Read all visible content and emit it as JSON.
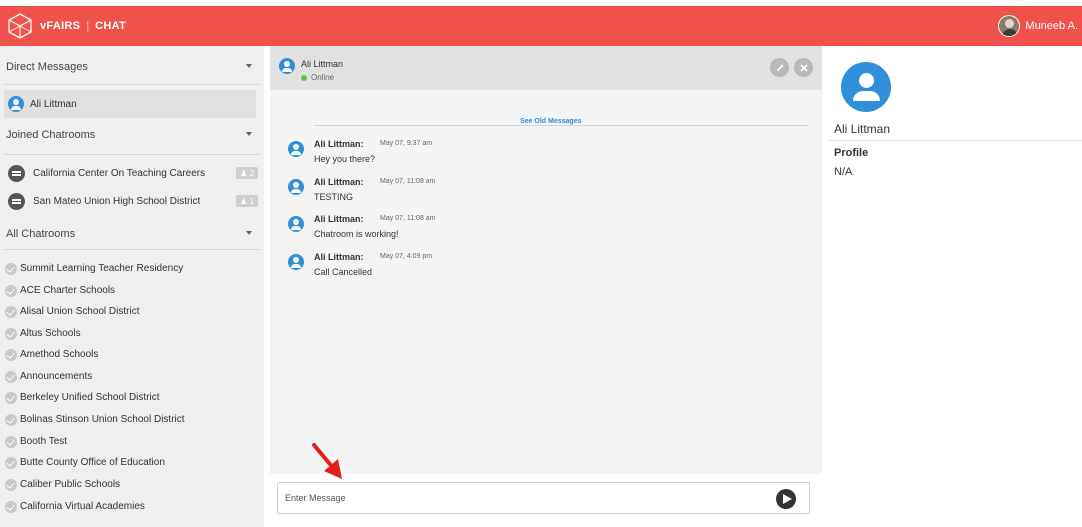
{
  "topbar": {
    "brand": "vFAIRS",
    "separator": "|",
    "section": "CHAT",
    "user_name": "Muneeb A."
  },
  "sidebar": {
    "direct_messages": {
      "title": "Direct Messages",
      "items": [
        {
          "label": "Ali Littman",
          "selected": true
        }
      ]
    },
    "joined_chatrooms": {
      "title": "Joined Chatrooms",
      "items": [
        {
          "label": "California Center On Teaching Careers",
          "badge": "2"
        },
        {
          "label": "San Mateo Union High School District",
          "badge": "1"
        }
      ]
    },
    "all_chatrooms": {
      "title": "All Chatrooms",
      "items": [
        "Summit Learning Teacher Residency",
        "ACE Charter Schools",
        "Alisal Union School District",
        "Altus Schools",
        "Amethod Schools",
        "Announcements",
        "Berkeley Unified School District",
        "Bolinas Stinson Union School District",
        "Booth Test",
        "Butte County Office of Education",
        "Caliber Public Schools",
        "California Virtual Academies"
      ]
    }
  },
  "chat": {
    "contact_name": "Ali Littman",
    "contact_status": "Online",
    "see_old": "See Old Messages",
    "messages": [
      {
        "author": "Ali Littman:",
        "time": "May 07, 9:37 am",
        "text": "Hey you there?"
      },
      {
        "author": "Ali Littman:",
        "time": "May 07, 11:08 am",
        "text": "TESTING"
      },
      {
        "author": "Ali Littman:",
        "time": "May 07, 11:08 am",
        "text": "Chatroom is working!"
      },
      {
        "author": "Ali Littman:",
        "time": "May 07, 4:09 pm",
        "text": "Call Cancelled"
      }
    ],
    "input_placeholder": "Enter Message",
    "input_value": ""
  },
  "profile": {
    "name": "Ali Littman",
    "section_label": "Profile",
    "section_value": "N/A"
  },
  "colors": {
    "brand_red": "#ef524a",
    "accent_blue": "#2f8fd8",
    "online_green": "#6bbf4e",
    "annotation_arrow": "#e0201b"
  }
}
